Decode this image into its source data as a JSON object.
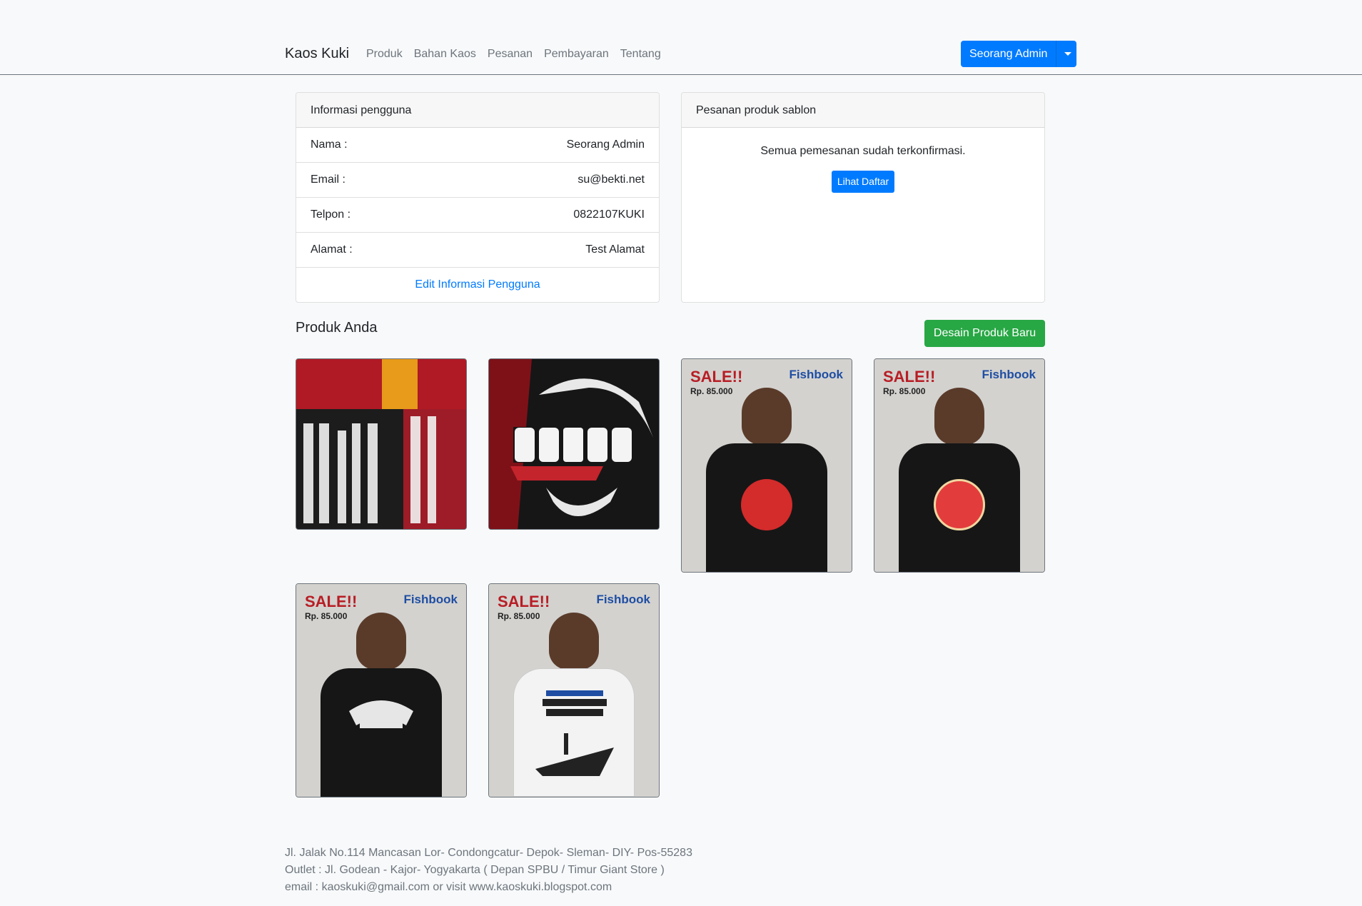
{
  "navbar": {
    "brand": "Kaos Kuki",
    "links": [
      "Produk",
      "Bahan Kaos",
      "Pesanan",
      "Pembayaran",
      "Tentang"
    ],
    "user_button": "Seorang Admin"
  },
  "user_info": {
    "header": "Informasi pengguna",
    "rows": [
      {
        "label": "Nama :",
        "value": "Seorang Admin"
      },
      {
        "label": "Email :",
        "value": "su@bekti.net"
      },
      {
        "label": "Telpon :",
        "value": "0822107KUKI"
      },
      {
        "label": "Alamat :",
        "value": "Test Alamat"
      }
    ],
    "edit_link": "Edit Informasi Pengguna"
  },
  "orders": {
    "header": "Pesanan produk sablon",
    "message": "Semua pemesanan sudah terkonfirmasi.",
    "button": "Lihat Daftar"
  },
  "products": {
    "title": "Produk Anda",
    "new_button": "Desain Produk Baru",
    "items": [
      {
        "kind": "photo-wisdom"
      },
      {
        "kind": "photo-gubug"
      },
      {
        "kind": "sale",
        "sale": "SALE!!",
        "price": "Rp. 85.000",
        "brand": "Fishbook",
        "shirt": "black",
        "print": "red"
      },
      {
        "kind": "sale",
        "sale": "SALE!!",
        "price": "Rp. 85.000",
        "brand": "Fishbook",
        "shirt": "black",
        "print": "red"
      },
      {
        "kind": "sale",
        "sale": "SALE!!",
        "price": "Rp. 85.000",
        "brand": "Fishbook",
        "shirt": "black",
        "print": "white"
      },
      {
        "kind": "sale",
        "sale": "SALE!!",
        "price": "Rp. 85.000",
        "brand": "Fishbook",
        "shirt": "white",
        "print": "dark"
      }
    ]
  },
  "footer": {
    "lines": [
      "Jl. Jalak No.114 Mancasan Lor- Condongcatur- Depok- Sleman- DIY- Pos-55283",
      "Outlet : Jl. Godean - Kajor- Yogyakarta ( Depan SPBU / Timur Giant Store )",
      "email : kaoskuki@gmail.com or visit www.kaoskuki.blogspot.com"
    ]
  },
  "colors": {
    "primary": "#007bff",
    "success": "#28a745",
    "background": "#f8f9fa",
    "muted": "#6c757d"
  }
}
